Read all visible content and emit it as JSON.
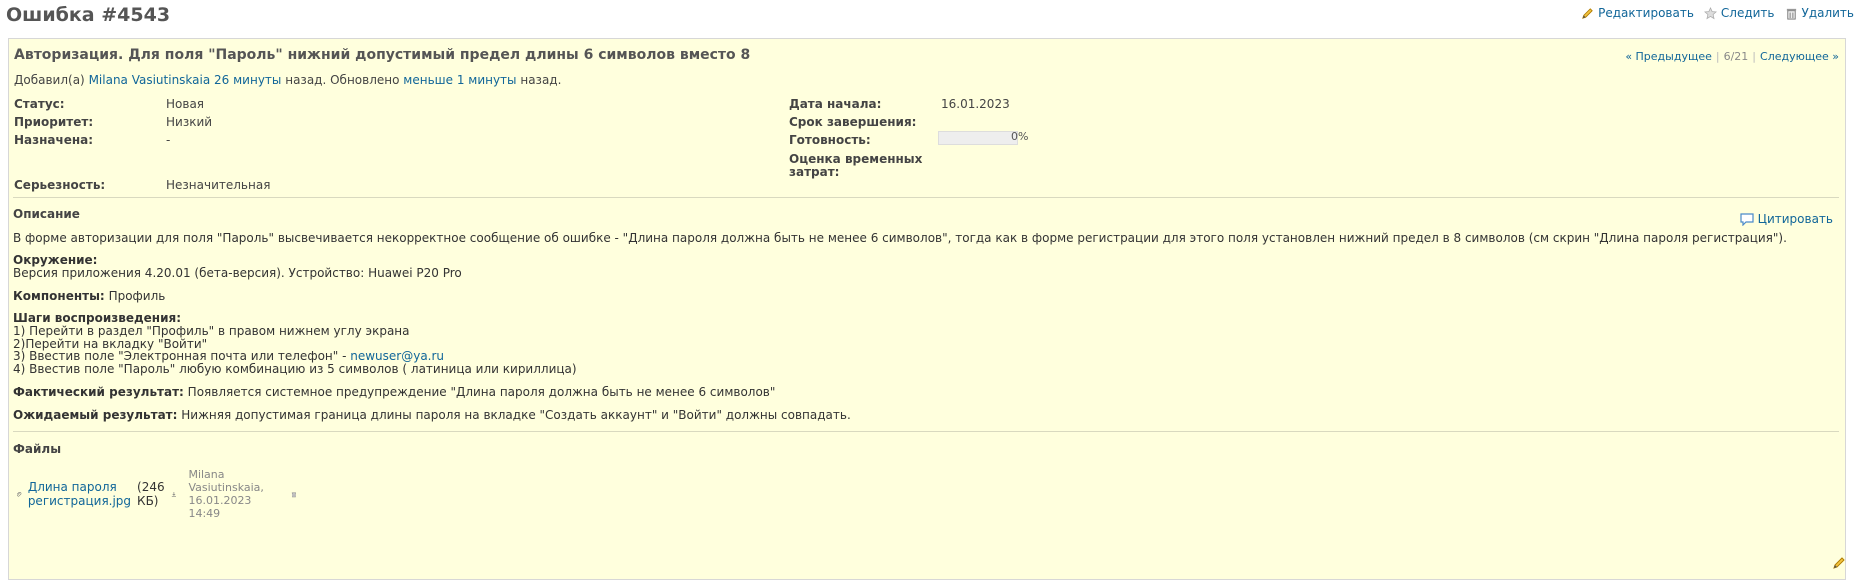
{
  "header": {
    "title": "Ошибка #4543",
    "actions": {
      "edit": "Редактировать",
      "watch": "Следить",
      "delete": "Удалить"
    }
  },
  "issue": {
    "subject": "Авторизация. Для поля \"Пароль\" нижний допустимый предел длины 6 символов вместо 8",
    "nav": {
      "prev": "« Предыдущее",
      "position": "6/21",
      "next": "Следующее »"
    },
    "author_line": {
      "prefix": "Добавил(а)",
      "author": "Milana Vasiutinskaia",
      "created_ago": "26 минуты",
      "mid": "назад. Обновлено",
      "updated_ago": "меньше 1 минуты",
      "suffix": "назад."
    },
    "attributes_left": [
      {
        "label": "Статус:",
        "value": "Новая"
      },
      {
        "label": "Приоритет:",
        "value": "Низкий"
      },
      {
        "label": "Назначена:",
        "value": "-"
      },
      {
        "label": "Серьезность:",
        "value": "Незначительная"
      }
    ],
    "attributes_right": {
      "start_date": {
        "label": "Дата начала:",
        "value": "16.01.2023"
      },
      "due_date": {
        "label": "Срок завершения:",
        "value": ""
      },
      "done": {
        "label": "Готовность:",
        "percent_text": "0%",
        "percent": 0
      },
      "estimate": {
        "label_line1": "Оценка временных",
        "label_line2": "затрат:",
        "value": ""
      }
    },
    "description": {
      "heading": "Описание",
      "quote_label": "Цитировать",
      "intro": "В форме авторизации для поля \"Пароль\" высвечивается некорректное сообщение об ошибке - \"Длина пароля должна быть не менее 6 символов\", тогда как в форме регистрации для этого поля установлен нижний предел в 8 символов (см скрин \"Длина пароля регистрация\").",
      "env_label": "Окружение:",
      "env_text": "Версия приложения 4.20.01 (бета-версия). Устройство: Huawei P20 Pro",
      "components_label": "Компоненты:",
      "components_value": "Профиль",
      "steps_label": "Шаги воспроизведения:",
      "step1": "1) Перейти в раздел \"Профиль\" в правом нижнем углу экрана",
      "step2": "2)Перейти на вкладку \"Войти\"",
      "step3_prefix": "3) Ввестив поле \"Электронная почта или телефон\" - ",
      "step3_link": "newuser@ya.ru",
      "step4": "4) Ввестив поле \"Пароль\" любую комбинацию из 5 символов ( латиница или кириллица)",
      "actual_label": "Фактический результат:",
      "actual_text": "Появляется системное предупреждение \"Длина пароля должна быть не менее 6 символов\"",
      "expected_label": "Ожидаемый результат:",
      "expected_text": "Нижняя допустимая граница длины пароля на вкладке \"Создать аккаунт\" и \"Войти\" должны совпадать."
    },
    "files": {
      "heading": "Файлы",
      "items": [
        {
          "name": "Длина пароля регистрация.jpg",
          "size": "(246 КБ)",
          "meta": "Milana Vasiutinskaia, 16.01.2023 14:49"
        }
      ]
    }
  },
  "colors": {
    "link": "#116699",
    "issue_background": "#ffffdd"
  }
}
